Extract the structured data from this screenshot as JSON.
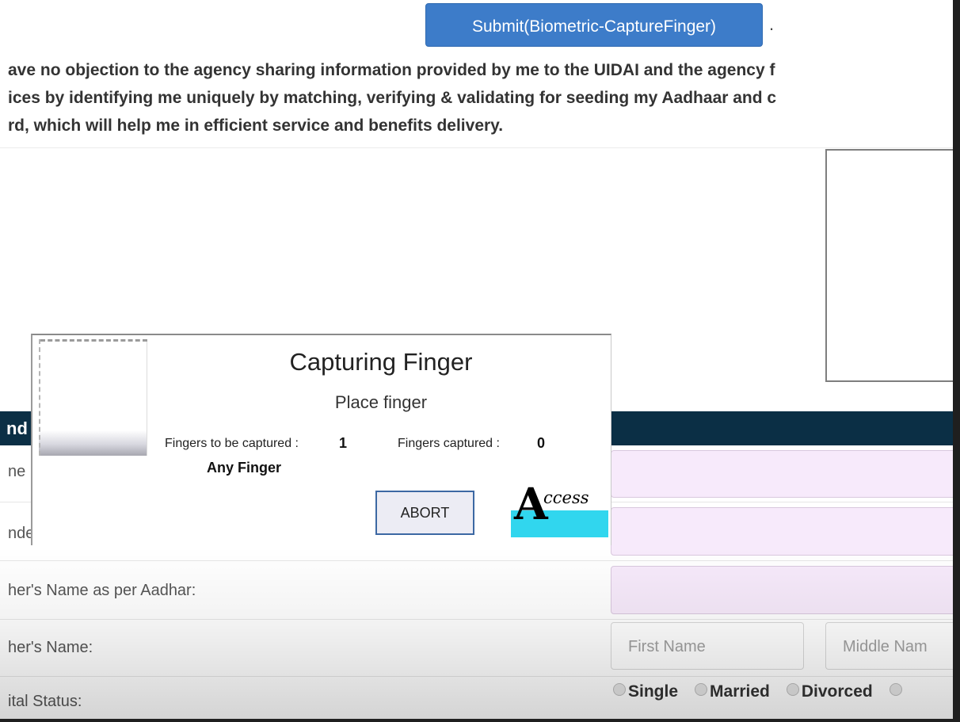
{
  "submit": {
    "label": "Submit(Biometric-CaptureFinger)",
    "suffix": "."
  },
  "consent": {
    "lines": [
      "ave no objection to the agency sharing information provided by me to the UIDAI and the agency f",
      "ices by identifying me uniquely by matching, verifying & validating for seeding my Aadhaar and c",
      "rd, which will help me in efficient service and benefits delivery."
    ]
  },
  "section": {
    "header_fragment": "nd"
  },
  "form": {
    "row1_label": "ne",
    "row2_label": "nde",
    "row3_label": "her's Name as per Aadhar:",
    "row4_label": "her's Name:",
    "row4_first_placeholder": "First Name",
    "row4_middle_placeholder": "Middle Nam",
    "row5_label": "ital Status:",
    "marital_options": [
      "Single",
      "Married",
      "Divorced"
    ]
  },
  "dialog": {
    "title": "Capturing Finger",
    "subtitle": "Place finger",
    "to_capture_label": "Fingers to be captured :",
    "to_capture_value": "1",
    "captured_label": "Fingers captured :",
    "captured_value": "0",
    "any_finger": "Any Finger",
    "abort_label": "ABORT",
    "logo_text": "ccess"
  },
  "colors": {
    "submit_bg": "#3d7cc9",
    "header_bg": "#0b2f45",
    "input_bg": "#f7eafb",
    "logo_cyan": "#31d6ee"
  }
}
